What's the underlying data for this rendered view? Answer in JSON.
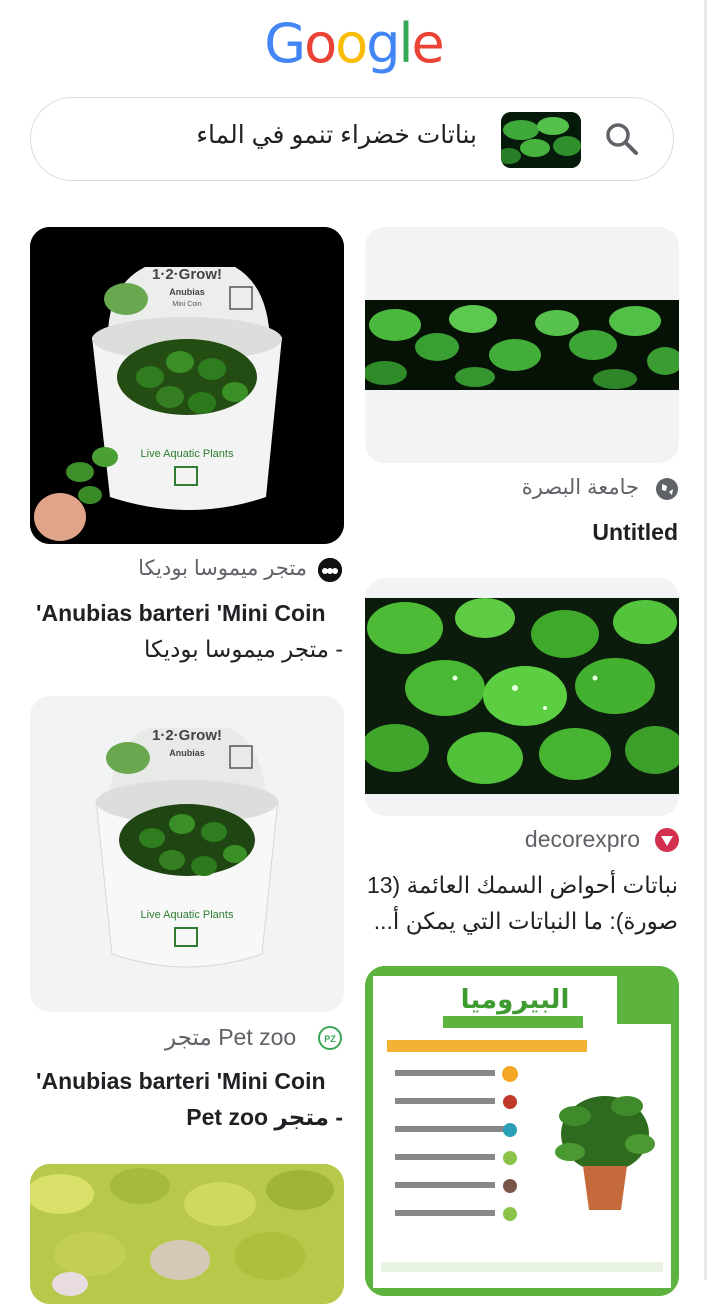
{
  "app": {
    "logo_letters": [
      "G",
      "o",
      "o",
      "g",
      "l",
      "e"
    ],
    "logo_colors": [
      "#4285F4",
      "#EA4335",
      "#FBBC05",
      "#4285F4",
      "#34A853",
      "#EA4335"
    ]
  },
  "search": {
    "query": "بناتات خضراء تنمو في الماء"
  },
  "results": [
    {
      "source": "جامعة البصرة",
      "title": "Untitled"
    },
    {
      "source": "متجر ميموسا بوديكا",
      "title_line1": "'Anubias barteri 'Mini Coin",
      "title_line2": "- متجر ميموسا بوديكا"
    },
    {
      "source": "decorexpro",
      "title_line1": "نباتات أحواض السمك العائمة (13",
      "title_line2": "صورة): ما النباتات التي يمكن أ..."
    },
    {
      "source_name": "Pet zoo",
      "source_suffix": "متجر",
      "title_line1": "'Anubias barteri 'Mini Coin",
      "title_line2": "- متجر Pet zoo"
    },
    {
      "poster_title": "البيروميا"
    }
  ],
  "product_labels": {
    "brand": "1·2·Grow!",
    "plant": "Anubias",
    "variant": "Mini Coin",
    "side": "Live Aquatic Plants"
  }
}
